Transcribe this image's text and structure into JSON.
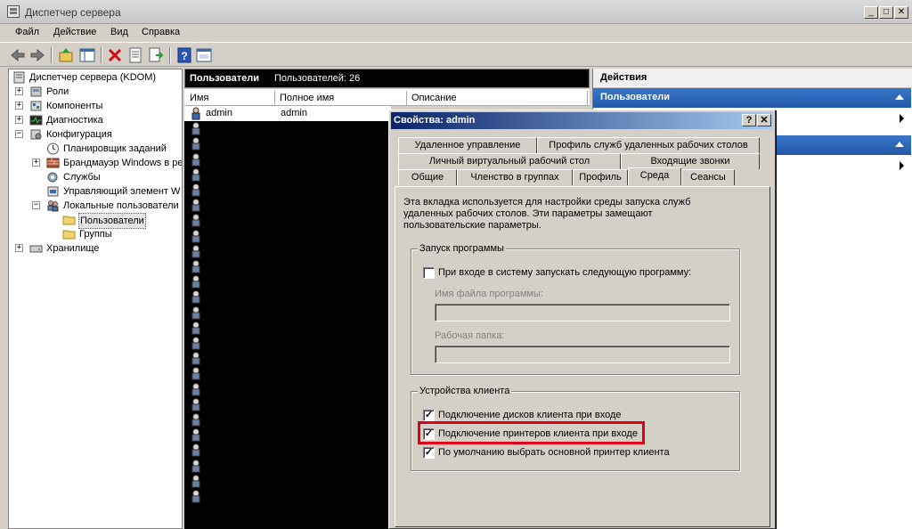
{
  "window": {
    "title": "Диспетчер сервера",
    "controls": [
      "_",
      "□",
      "✕"
    ]
  },
  "menu": [
    "Файл",
    "Действие",
    "Вид",
    "Справка"
  ],
  "toolbar": {
    "icons": [
      "back-icon",
      "forward-icon",
      "up-icon",
      "show-hide-tree-icon",
      "delete-icon",
      "properties-icon",
      "export-icon",
      "help-icon",
      "console-icon"
    ]
  },
  "tree": {
    "items": [
      {
        "label": "Диспетчер сервера (KDOM)",
        "icon": "server-manager-icon"
      },
      {
        "label": "Роли",
        "icon": "roles-icon"
      },
      {
        "label": "Компоненты",
        "icon": "features-icon"
      },
      {
        "label": "Диагностика",
        "icon": "diagnostics-icon"
      },
      {
        "label": "Конфигурация",
        "icon": "configuration-icon"
      },
      {
        "label": "Планировщик заданий",
        "icon": "task-scheduler-icon"
      },
      {
        "label": "Брандмауэр Windows в ре",
        "icon": "firewall-icon"
      },
      {
        "label": "Службы",
        "icon": "services-icon"
      },
      {
        "label": "Управляющий элемент W",
        "icon": "wmi-icon"
      },
      {
        "label": "Локальные пользователи",
        "icon": "local-users-icon"
      },
      {
        "label": "Пользователи",
        "icon": "folder-icon"
      },
      {
        "label": "Группы",
        "icon": "folder-icon"
      },
      {
        "label": "Хранилище",
        "icon": "storage-icon"
      }
    ]
  },
  "users_panel": {
    "title": "Пользователи",
    "count_text": "Пользователей: 26",
    "columns": [
      "Имя",
      "Полное имя",
      "Описание"
    ],
    "first_row": {
      "name": "admin",
      "full_name": "admin"
    }
  },
  "actions_panel": {
    "header": "Действия",
    "section1": "Пользователи"
  },
  "dialog": {
    "title": "Свойства: admin",
    "help_btn": "?",
    "close_btn": "✕",
    "tabs_row1": [
      "Удаленное управление",
      "Профиль служб удаленных рабочих столов"
    ],
    "tabs_row2": [
      "Личный виртуальный рабочий стол",
      "Входящие звонки"
    ],
    "tabs_row3": [
      "Общие",
      "Членство в группах",
      "Профиль",
      "Среда",
      "Сеансы"
    ],
    "active_tab": "Среда",
    "intro": "Эта вкладка используется для настройки среды запуска служб удаленных рабочих столов. Эти параметры замещают пользовательские параметры.",
    "startup_group": {
      "title": "Запуск программы",
      "checkbox_label": "При входе в систему запускать следующую программу:",
      "checked": false,
      "program_label": "Имя файла программы:",
      "program_value": "",
      "workdir_label": "Рабочая папка:",
      "workdir_value": ""
    },
    "client_group": {
      "title": "Устройства клиента",
      "drives_label": "Подключение дисков клиента при входе",
      "printers_label": "Подключение принтеров клиента при входе",
      "default_printer_label": "По умолчанию выбрать основной принтер клиента",
      "check_mark": "✓"
    }
  }
}
